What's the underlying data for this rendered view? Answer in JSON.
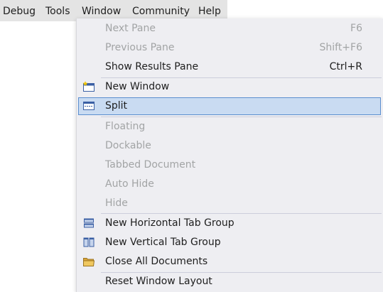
{
  "menubar": {
    "items": [
      {
        "label": "Debug"
      },
      {
        "label": "Tools"
      },
      {
        "label": "Window"
      },
      {
        "label": "Community"
      },
      {
        "label": "Help"
      }
    ]
  },
  "window_menu": {
    "items": [
      {
        "label": "Next Pane",
        "shortcut": "F6",
        "enabled": false,
        "icon": ""
      },
      {
        "label": "Previous Pane",
        "shortcut": "Shift+F6",
        "enabled": false,
        "icon": ""
      },
      {
        "label": "Show Results Pane",
        "shortcut": "Ctrl+R",
        "enabled": true,
        "icon": ""
      },
      {
        "label": "New Window",
        "shortcut": "",
        "enabled": true,
        "icon": "new-window-icon"
      },
      {
        "label": "Split",
        "shortcut": "",
        "enabled": true,
        "highlighted": true,
        "icon": "split-icon"
      },
      {
        "label": "Floating",
        "shortcut": "",
        "enabled": false,
        "icon": ""
      },
      {
        "label": "Dockable",
        "shortcut": "",
        "enabled": false,
        "icon": ""
      },
      {
        "label": "Tabbed Document",
        "shortcut": "",
        "enabled": false,
        "icon": ""
      },
      {
        "label": "Auto Hide",
        "shortcut": "",
        "enabled": false,
        "icon": ""
      },
      {
        "label": "Hide",
        "shortcut": "",
        "enabled": false,
        "icon": ""
      },
      {
        "label": "New Horizontal Tab Group",
        "shortcut": "",
        "enabled": true,
        "icon": "horizontal-tab-group-icon"
      },
      {
        "label": "New Vertical Tab Group",
        "shortcut": "",
        "enabled": true,
        "icon": "vertical-tab-group-icon"
      },
      {
        "label": "Close All Documents",
        "shortcut": "",
        "enabled": true,
        "icon": "folder-icon"
      },
      {
        "label": "Reset Window Layout",
        "shortcut": "",
        "enabled": true,
        "icon": ""
      }
    ]
  },
  "colors": {
    "menubar_bg": "#e4e4e4",
    "menu_bg": "#eeeef2",
    "highlight_bg": "#c9dbf2",
    "highlight_border": "#5b8ecf",
    "disabled_text": "#a2a4a5",
    "icon_blue": "#3a5fa4",
    "folder_yellow": "#e8b84a"
  }
}
